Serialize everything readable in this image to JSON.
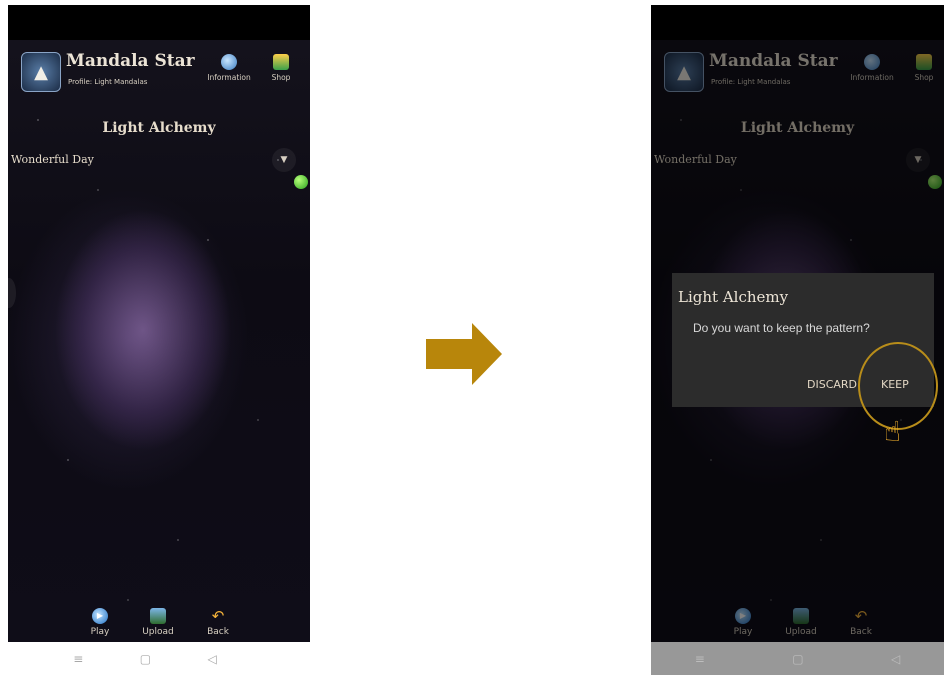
{
  "app": {
    "title": "Mandala Star",
    "profile": "Profile: Light Mandalas",
    "info_label": "Information",
    "shop_label": "Shop"
  },
  "screen": {
    "section_title": "Light Alchemy",
    "dropdown_value": "Wonderful Day",
    "dropdown_icon": "chevron-down-icon",
    "status_color": "#3cc22a"
  },
  "bottom": {
    "play": "Play",
    "upload": "Upload",
    "back": "Back"
  },
  "navbar": {
    "menu_icon": "≡",
    "home_icon": "▢",
    "back_icon": "◁"
  },
  "dialog": {
    "title": "Light Alchemy",
    "message": "Do you want to keep the pattern?",
    "discard": "DISCARD",
    "keep": "KEEP"
  },
  "colors": {
    "arrow": "#b8860b",
    "highlight": "#b88d1a",
    "hand": "#f3b12d"
  }
}
